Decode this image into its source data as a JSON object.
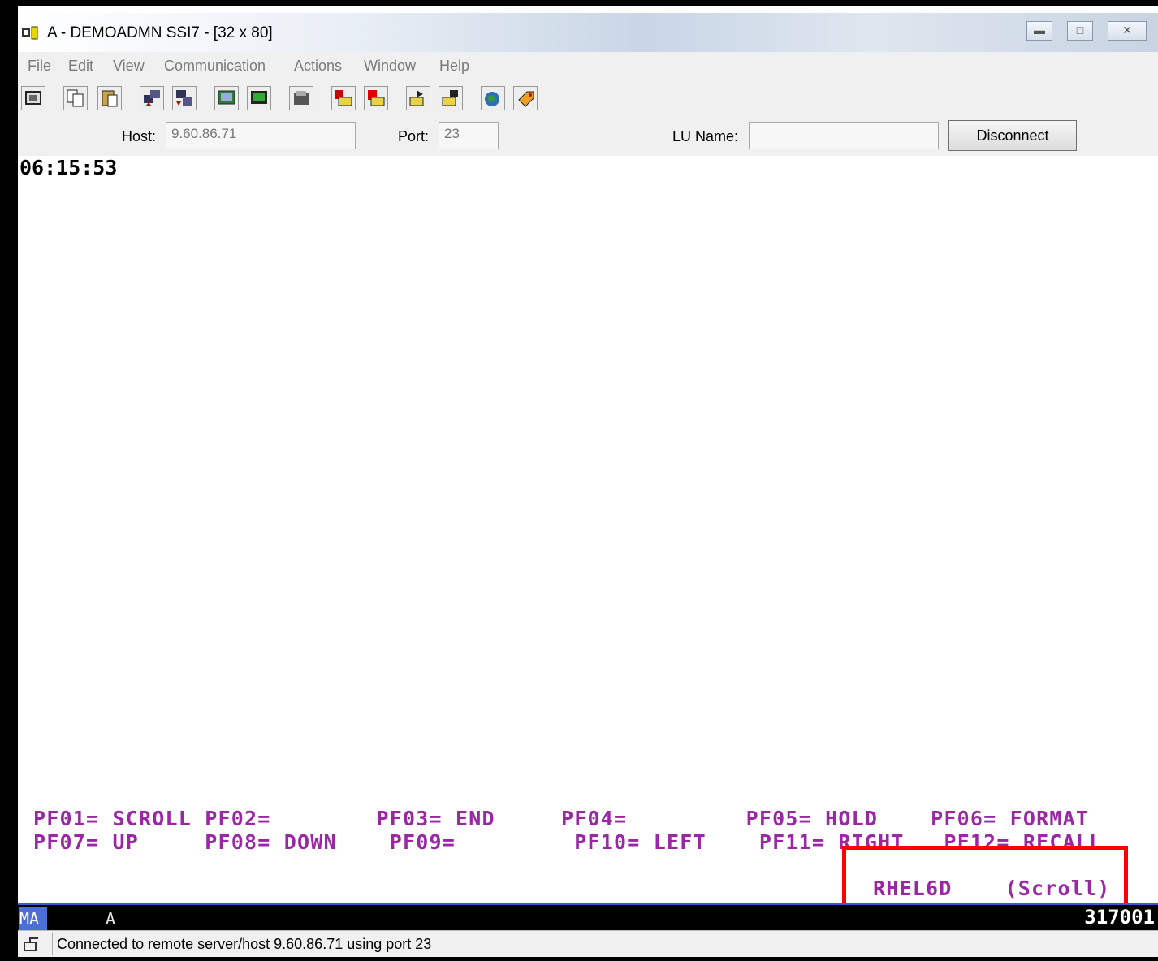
{
  "window": {
    "title": "A - DEMOADMN SSI7 - [32 x 80]",
    "controls": [
      "minimize",
      "maximize",
      "close"
    ]
  },
  "menu": [
    "File",
    "Edit",
    "View",
    "Communication",
    "Actions",
    "Window",
    "Help"
  ],
  "toolbar": {
    "icons": [
      "print-screen-icon",
      "copy-icon",
      "paste-icon",
      "send-file-icon",
      "receive-file-icon",
      "display-setup-icon",
      "keyboard-setup-icon",
      "macro-icon",
      "record-macro-icon",
      "stop-macro-icon",
      "play-macro-icon",
      "macro-edit-icon",
      "web-icon",
      "tag-icon"
    ]
  },
  "connection": {
    "host_label": "Host:",
    "host_value": "9.60.86.71",
    "port_label": "Port:",
    "port_value": "23",
    "lu_label": "LU Name:",
    "lu_value": "",
    "disconnect_label": "Disconnect"
  },
  "terminal": {
    "clock": "06:15:53",
    "pf_row1": "PF01= SCROLL PF02=        PF03= END     PF04=         PF05= HOLD    PF06= FORMAT",
    "pf_row2": "PF07= UP     PF08= DOWN    PF09=         PF10= LEFT    PF11= RIGHT   PF12= RECALL",
    "status_line": "RHEL6D    (Scroll)",
    "highlight_color": "#ff0000",
    "pf_color": "#9a27a4"
  },
  "oia": {
    "mode": "MA",
    "session": "A",
    "position": "317001"
  },
  "statusbar": {
    "text": "Connected to remote server/host 9.60.86.71 using port 23"
  }
}
